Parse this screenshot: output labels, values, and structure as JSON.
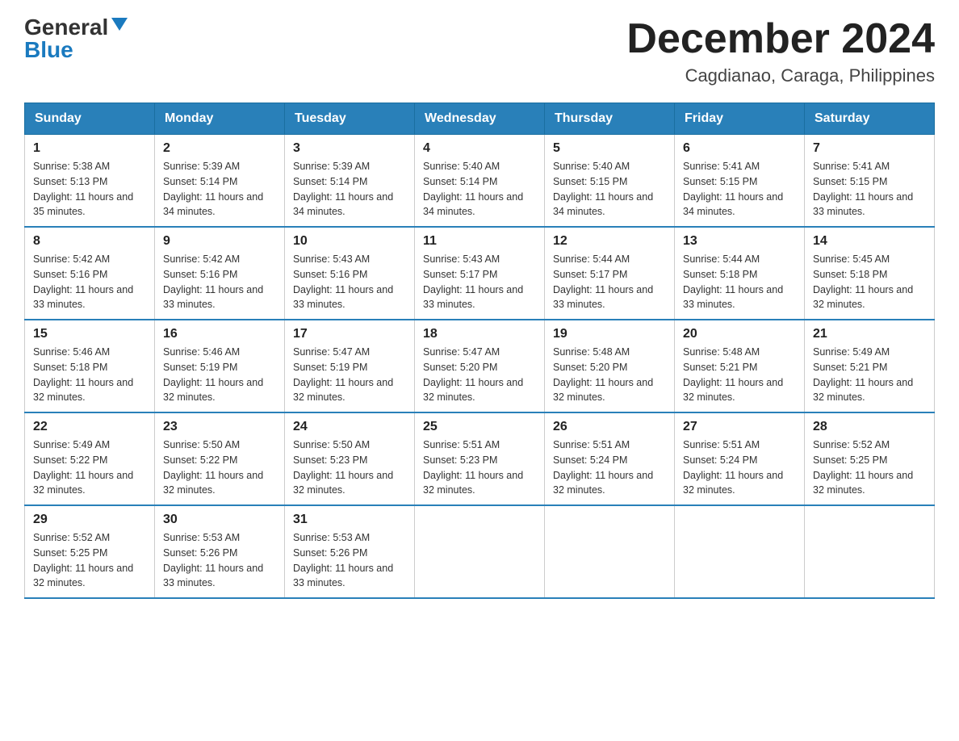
{
  "header": {
    "logo": {
      "general": "General",
      "blue": "Blue"
    },
    "title": "December 2024",
    "location": "Cagdianao, Caraga, Philippines"
  },
  "calendar": {
    "days_of_week": [
      "Sunday",
      "Monday",
      "Tuesday",
      "Wednesday",
      "Thursday",
      "Friday",
      "Saturday"
    ],
    "weeks": [
      [
        {
          "day": "1",
          "sunrise": "5:38 AM",
          "sunset": "5:13 PM",
          "daylight": "11 hours and 35 minutes."
        },
        {
          "day": "2",
          "sunrise": "5:39 AM",
          "sunset": "5:14 PM",
          "daylight": "11 hours and 34 minutes."
        },
        {
          "day": "3",
          "sunrise": "5:39 AM",
          "sunset": "5:14 PM",
          "daylight": "11 hours and 34 minutes."
        },
        {
          "day": "4",
          "sunrise": "5:40 AM",
          "sunset": "5:14 PM",
          "daylight": "11 hours and 34 minutes."
        },
        {
          "day": "5",
          "sunrise": "5:40 AM",
          "sunset": "5:15 PM",
          "daylight": "11 hours and 34 minutes."
        },
        {
          "day": "6",
          "sunrise": "5:41 AM",
          "sunset": "5:15 PM",
          "daylight": "11 hours and 34 minutes."
        },
        {
          "day": "7",
          "sunrise": "5:41 AM",
          "sunset": "5:15 PM",
          "daylight": "11 hours and 33 minutes."
        }
      ],
      [
        {
          "day": "8",
          "sunrise": "5:42 AM",
          "sunset": "5:16 PM",
          "daylight": "11 hours and 33 minutes."
        },
        {
          "day": "9",
          "sunrise": "5:42 AM",
          "sunset": "5:16 PM",
          "daylight": "11 hours and 33 minutes."
        },
        {
          "day": "10",
          "sunrise": "5:43 AM",
          "sunset": "5:16 PM",
          "daylight": "11 hours and 33 minutes."
        },
        {
          "day": "11",
          "sunrise": "5:43 AM",
          "sunset": "5:17 PM",
          "daylight": "11 hours and 33 minutes."
        },
        {
          "day": "12",
          "sunrise": "5:44 AM",
          "sunset": "5:17 PM",
          "daylight": "11 hours and 33 minutes."
        },
        {
          "day": "13",
          "sunrise": "5:44 AM",
          "sunset": "5:18 PM",
          "daylight": "11 hours and 33 minutes."
        },
        {
          "day": "14",
          "sunrise": "5:45 AM",
          "sunset": "5:18 PM",
          "daylight": "11 hours and 32 minutes."
        }
      ],
      [
        {
          "day": "15",
          "sunrise": "5:46 AM",
          "sunset": "5:18 PM",
          "daylight": "11 hours and 32 minutes."
        },
        {
          "day": "16",
          "sunrise": "5:46 AM",
          "sunset": "5:19 PM",
          "daylight": "11 hours and 32 minutes."
        },
        {
          "day": "17",
          "sunrise": "5:47 AM",
          "sunset": "5:19 PM",
          "daylight": "11 hours and 32 minutes."
        },
        {
          "day": "18",
          "sunrise": "5:47 AM",
          "sunset": "5:20 PM",
          "daylight": "11 hours and 32 minutes."
        },
        {
          "day": "19",
          "sunrise": "5:48 AM",
          "sunset": "5:20 PM",
          "daylight": "11 hours and 32 minutes."
        },
        {
          "day": "20",
          "sunrise": "5:48 AM",
          "sunset": "5:21 PM",
          "daylight": "11 hours and 32 minutes."
        },
        {
          "day": "21",
          "sunrise": "5:49 AM",
          "sunset": "5:21 PM",
          "daylight": "11 hours and 32 minutes."
        }
      ],
      [
        {
          "day": "22",
          "sunrise": "5:49 AM",
          "sunset": "5:22 PM",
          "daylight": "11 hours and 32 minutes."
        },
        {
          "day": "23",
          "sunrise": "5:50 AM",
          "sunset": "5:22 PM",
          "daylight": "11 hours and 32 minutes."
        },
        {
          "day": "24",
          "sunrise": "5:50 AM",
          "sunset": "5:23 PM",
          "daylight": "11 hours and 32 minutes."
        },
        {
          "day": "25",
          "sunrise": "5:51 AM",
          "sunset": "5:23 PM",
          "daylight": "11 hours and 32 minutes."
        },
        {
          "day": "26",
          "sunrise": "5:51 AM",
          "sunset": "5:24 PM",
          "daylight": "11 hours and 32 minutes."
        },
        {
          "day": "27",
          "sunrise": "5:51 AM",
          "sunset": "5:24 PM",
          "daylight": "11 hours and 32 minutes."
        },
        {
          "day": "28",
          "sunrise": "5:52 AM",
          "sunset": "5:25 PM",
          "daylight": "11 hours and 32 minutes."
        }
      ],
      [
        {
          "day": "29",
          "sunrise": "5:52 AM",
          "sunset": "5:25 PM",
          "daylight": "11 hours and 32 minutes."
        },
        {
          "day": "30",
          "sunrise": "5:53 AM",
          "sunset": "5:26 PM",
          "daylight": "11 hours and 33 minutes."
        },
        {
          "day": "31",
          "sunrise": "5:53 AM",
          "sunset": "5:26 PM",
          "daylight": "11 hours and 33 minutes."
        },
        null,
        null,
        null,
        null
      ]
    ]
  }
}
